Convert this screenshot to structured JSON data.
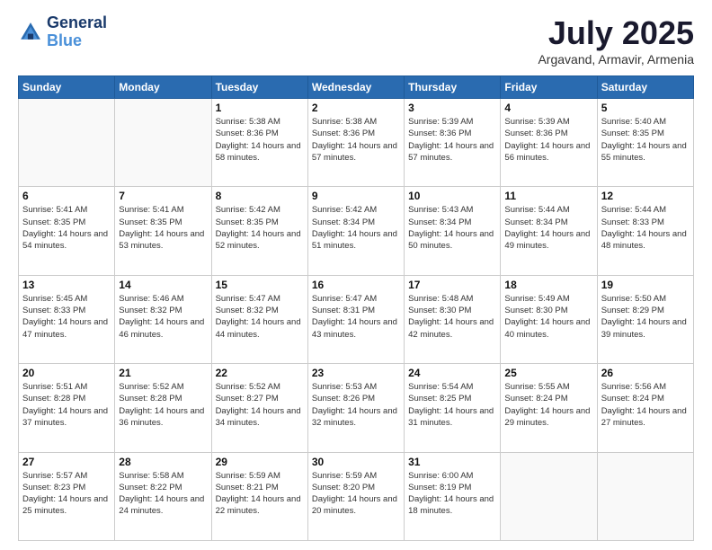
{
  "logo": {
    "line1": "General",
    "line2": "Blue"
  },
  "title": "July 2025",
  "location": "Argavand, Armavir, Armenia",
  "days_of_week": [
    "Sunday",
    "Monday",
    "Tuesday",
    "Wednesday",
    "Thursday",
    "Friday",
    "Saturday"
  ],
  "weeks": [
    [
      {
        "day": "",
        "info": "",
        "empty": true
      },
      {
        "day": "",
        "info": "",
        "empty": true
      },
      {
        "day": "1",
        "info": "Sunrise: 5:38 AM\nSunset: 8:36 PM\nDaylight: 14 hours and 58 minutes."
      },
      {
        "day": "2",
        "info": "Sunrise: 5:38 AM\nSunset: 8:36 PM\nDaylight: 14 hours and 57 minutes."
      },
      {
        "day": "3",
        "info": "Sunrise: 5:39 AM\nSunset: 8:36 PM\nDaylight: 14 hours and 57 minutes."
      },
      {
        "day": "4",
        "info": "Sunrise: 5:39 AM\nSunset: 8:36 PM\nDaylight: 14 hours and 56 minutes."
      },
      {
        "day": "5",
        "info": "Sunrise: 5:40 AM\nSunset: 8:35 PM\nDaylight: 14 hours and 55 minutes."
      }
    ],
    [
      {
        "day": "6",
        "info": "Sunrise: 5:41 AM\nSunset: 8:35 PM\nDaylight: 14 hours and 54 minutes."
      },
      {
        "day": "7",
        "info": "Sunrise: 5:41 AM\nSunset: 8:35 PM\nDaylight: 14 hours and 53 minutes."
      },
      {
        "day": "8",
        "info": "Sunrise: 5:42 AM\nSunset: 8:35 PM\nDaylight: 14 hours and 52 minutes."
      },
      {
        "day": "9",
        "info": "Sunrise: 5:42 AM\nSunset: 8:34 PM\nDaylight: 14 hours and 51 minutes."
      },
      {
        "day": "10",
        "info": "Sunrise: 5:43 AM\nSunset: 8:34 PM\nDaylight: 14 hours and 50 minutes."
      },
      {
        "day": "11",
        "info": "Sunrise: 5:44 AM\nSunset: 8:34 PM\nDaylight: 14 hours and 49 minutes."
      },
      {
        "day": "12",
        "info": "Sunrise: 5:44 AM\nSunset: 8:33 PM\nDaylight: 14 hours and 48 minutes."
      }
    ],
    [
      {
        "day": "13",
        "info": "Sunrise: 5:45 AM\nSunset: 8:33 PM\nDaylight: 14 hours and 47 minutes."
      },
      {
        "day": "14",
        "info": "Sunrise: 5:46 AM\nSunset: 8:32 PM\nDaylight: 14 hours and 46 minutes."
      },
      {
        "day": "15",
        "info": "Sunrise: 5:47 AM\nSunset: 8:32 PM\nDaylight: 14 hours and 44 minutes."
      },
      {
        "day": "16",
        "info": "Sunrise: 5:47 AM\nSunset: 8:31 PM\nDaylight: 14 hours and 43 minutes."
      },
      {
        "day": "17",
        "info": "Sunrise: 5:48 AM\nSunset: 8:30 PM\nDaylight: 14 hours and 42 minutes."
      },
      {
        "day": "18",
        "info": "Sunrise: 5:49 AM\nSunset: 8:30 PM\nDaylight: 14 hours and 40 minutes."
      },
      {
        "day": "19",
        "info": "Sunrise: 5:50 AM\nSunset: 8:29 PM\nDaylight: 14 hours and 39 minutes."
      }
    ],
    [
      {
        "day": "20",
        "info": "Sunrise: 5:51 AM\nSunset: 8:28 PM\nDaylight: 14 hours and 37 minutes."
      },
      {
        "day": "21",
        "info": "Sunrise: 5:52 AM\nSunset: 8:28 PM\nDaylight: 14 hours and 36 minutes."
      },
      {
        "day": "22",
        "info": "Sunrise: 5:52 AM\nSunset: 8:27 PM\nDaylight: 14 hours and 34 minutes."
      },
      {
        "day": "23",
        "info": "Sunrise: 5:53 AM\nSunset: 8:26 PM\nDaylight: 14 hours and 32 minutes."
      },
      {
        "day": "24",
        "info": "Sunrise: 5:54 AM\nSunset: 8:25 PM\nDaylight: 14 hours and 31 minutes."
      },
      {
        "day": "25",
        "info": "Sunrise: 5:55 AM\nSunset: 8:24 PM\nDaylight: 14 hours and 29 minutes."
      },
      {
        "day": "26",
        "info": "Sunrise: 5:56 AM\nSunset: 8:24 PM\nDaylight: 14 hours and 27 minutes."
      }
    ],
    [
      {
        "day": "27",
        "info": "Sunrise: 5:57 AM\nSunset: 8:23 PM\nDaylight: 14 hours and 25 minutes."
      },
      {
        "day": "28",
        "info": "Sunrise: 5:58 AM\nSunset: 8:22 PM\nDaylight: 14 hours and 24 minutes."
      },
      {
        "day": "29",
        "info": "Sunrise: 5:59 AM\nSunset: 8:21 PM\nDaylight: 14 hours and 22 minutes."
      },
      {
        "day": "30",
        "info": "Sunrise: 5:59 AM\nSunset: 8:20 PM\nDaylight: 14 hours and 20 minutes."
      },
      {
        "day": "31",
        "info": "Sunrise: 6:00 AM\nSunset: 8:19 PM\nDaylight: 14 hours and 18 minutes."
      },
      {
        "day": "",
        "info": "",
        "empty": true
      },
      {
        "day": "",
        "info": "",
        "empty": true
      }
    ]
  ]
}
